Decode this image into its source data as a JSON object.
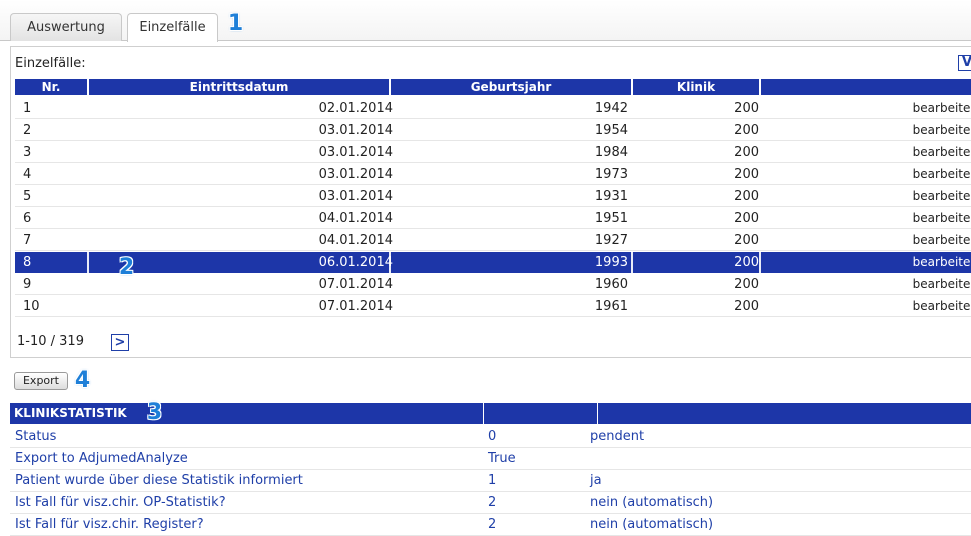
{
  "tabs": [
    {
      "label": "Auswertung",
      "active": false
    },
    {
      "label": "Einzelfälle",
      "active": true
    }
  ],
  "callouts": [
    "1",
    "2",
    "3",
    "4"
  ],
  "einzelfaelle": {
    "title": "Einzelfälle:",
    "view_button": "V",
    "columns": [
      "Nr.",
      "Eintrittsdatum",
      "Geburtsjahr",
      "Klinik"
    ],
    "rows": [
      {
        "nr": "1",
        "eintrittsdatum": "02.01.2014",
        "geburtsjahr": "1942",
        "klinik": "200",
        "action": "bearbeiten"
      },
      {
        "nr": "2",
        "eintrittsdatum": "03.01.2014",
        "geburtsjahr": "1954",
        "klinik": "200",
        "action": "bearbeiten"
      },
      {
        "nr": "3",
        "eintrittsdatum": "03.01.2014",
        "geburtsjahr": "1984",
        "klinik": "200",
        "action": "bearbeiten"
      },
      {
        "nr": "4",
        "eintrittsdatum": "03.01.2014",
        "geburtsjahr": "1973",
        "klinik": "200",
        "action": "bearbeiten"
      },
      {
        "nr": "5",
        "eintrittsdatum": "03.01.2014",
        "geburtsjahr": "1931",
        "klinik": "200",
        "action": "bearbeiten"
      },
      {
        "nr": "6",
        "eintrittsdatum": "04.01.2014",
        "geburtsjahr": "1951",
        "klinik": "200",
        "action": "bearbeiten"
      },
      {
        "nr": "7",
        "eintrittsdatum": "04.01.2014",
        "geburtsjahr": "1927",
        "klinik": "200",
        "action": "bearbeiten"
      },
      {
        "nr": "8",
        "eintrittsdatum": "06.01.2014",
        "geburtsjahr": "1993",
        "klinik": "200",
        "action": "bearbeiten",
        "selected": true
      },
      {
        "nr": "9",
        "eintrittsdatum": "07.01.2014",
        "geburtsjahr": "1960",
        "klinik": "200",
        "action": "bearbeiten"
      },
      {
        "nr": "10",
        "eintrittsdatum": "07.01.2014",
        "geburtsjahr": "1961",
        "klinik": "200",
        "action": "bearbeiten"
      }
    ],
    "pager": {
      "range": "1-10 / 319",
      "next": ">"
    }
  },
  "export_label": "Export",
  "klinikstatistik": {
    "title": "KLINIKSTATISTIK",
    "rows": [
      {
        "label": "Status",
        "code": "0",
        "text": "pendent"
      },
      {
        "label": "Export to AdjumedAnalyze",
        "code": "True",
        "text": ""
      },
      {
        "label": "Patient wurde über diese Statistik informiert",
        "code": "1",
        "text": "ja"
      },
      {
        "label": "Ist Fall für visz.chir. OP-Statistik?",
        "code": "2",
        "text": "nein (automatisch)"
      },
      {
        "label": "Ist Fall für visz.chir. Register?",
        "code": "2",
        "text": "nein (automatisch)"
      }
    ]
  },
  "colors": {
    "header_blue": "#1d36a8",
    "link_blue": "#1f3fa8",
    "callout_blue": "#1e7fd8"
  }
}
